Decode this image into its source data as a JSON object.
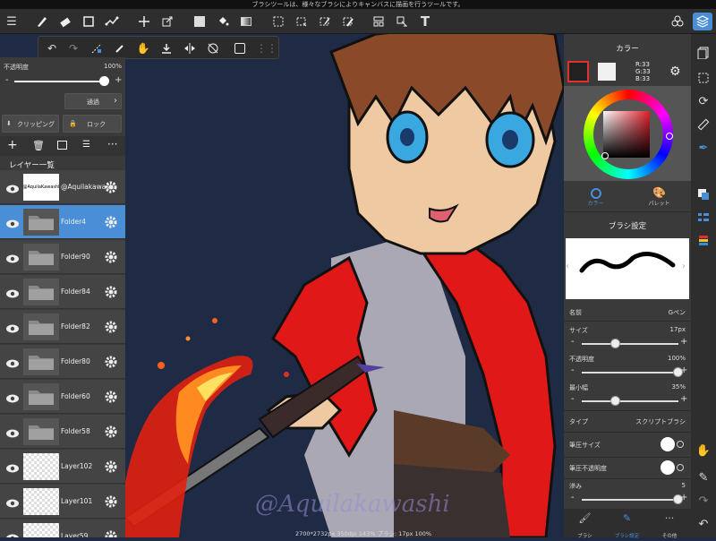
{
  "status_bar": {
    "message": "ブラシツールは、様々なブラシによりキャンバスに描画を行うツールです。"
  },
  "toolbar": {
    "menu_icon": "☰",
    "tools": [
      "brush-tool",
      "eraser-tool",
      "select-rect-tool",
      "magic-wand-tool",
      "move-tool",
      "transform-tool",
      "fill-color-tool",
      "bucket-tool",
      "gradient-tool",
      "select-tool",
      "lasso-tool",
      "eyedropper-tool",
      "select-pen-tool",
      "frame-tool",
      "pick-tool",
      "text-tool"
    ],
    "text_tool_label": "T"
  },
  "subbar": {
    "items": [
      "undo",
      "redo",
      "snap",
      "eyedropper",
      "hand",
      "import",
      "flip",
      "rotate-lock",
      "flatten",
      "grip"
    ]
  },
  "layer_panel": {
    "opacity_label": "不透明度",
    "opacity_value": "100%",
    "blend_mode": "通過",
    "clipping_label": "クリッピング",
    "lock_label": "ロック",
    "list_title": "レイヤー一覧",
    "layers": [
      {
        "name": "@Aquilakawashi",
        "type": "text",
        "selected": false
      },
      {
        "name": "Folder4",
        "type": "folder",
        "selected": true
      },
      {
        "name": "Folder90",
        "type": "folder",
        "selected": false
      },
      {
        "name": "Folder84",
        "type": "folder",
        "selected": false
      },
      {
        "name": "Folder82",
        "type": "folder",
        "selected": false
      },
      {
        "name": "Folder80",
        "type": "folder",
        "selected": false
      },
      {
        "name": "Folder60",
        "type": "folder",
        "selected": false
      },
      {
        "name": "Folder58",
        "type": "folder",
        "selected": false
      },
      {
        "name": "Layer102",
        "type": "layer",
        "selected": false
      },
      {
        "name": "Layer101",
        "type": "layer",
        "selected": false
      },
      {
        "name": "Layer59",
        "type": "layer",
        "selected": false
      }
    ],
    "text_thumb_label": "@AquilaKawashi"
  },
  "canvas": {
    "info": "2700*2732px 350dpi 143% ブラシ: 17px 100%",
    "watermark": "@Aquilakawashi"
  },
  "color_panel": {
    "title": "カラー",
    "r": "R:33",
    "g": "G:33",
    "b": "B:33",
    "tab_color": "カラー",
    "tab_palette": "パレット",
    "fg_color": "#212121",
    "bg_color": "#f0f0f0",
    "hue_color": "#e0202a"
  },
  "brush_panel": {
    "title": "ブラシ設定",
    "name_label": "名前",
    "name_value": "Gペン",
    "size_label": "サイズ",
    "size_value": "17px",
    "size_level": 0.35,
    "opacity_label": "不透明度",
    "opacity_value": "100%",
    "opacity_level": 1.0,
    "min_width_label": "最小幅",
    "min_width_value": "35%",
    "min_width_level": 0.35,
    "type_label": "タイプ",
    "type_value": "スクリプトブラシ",
    "pressure_size_label": "筆圧サイズ",
    "pressure_opacity_label": "筆圧不透明度",
    "stroke_label": "滲み",
    "stroke_value": "5",
    "stroke_level": 1.0
  },
  "bottom_tabs": [
    {
      "label": "ブラシ"
    },
    {
      "label": "ブラシ設定"
    },
    {
      "label": "その他"
    }
  ],
  "accent_color": "#4a8fd6"
}
